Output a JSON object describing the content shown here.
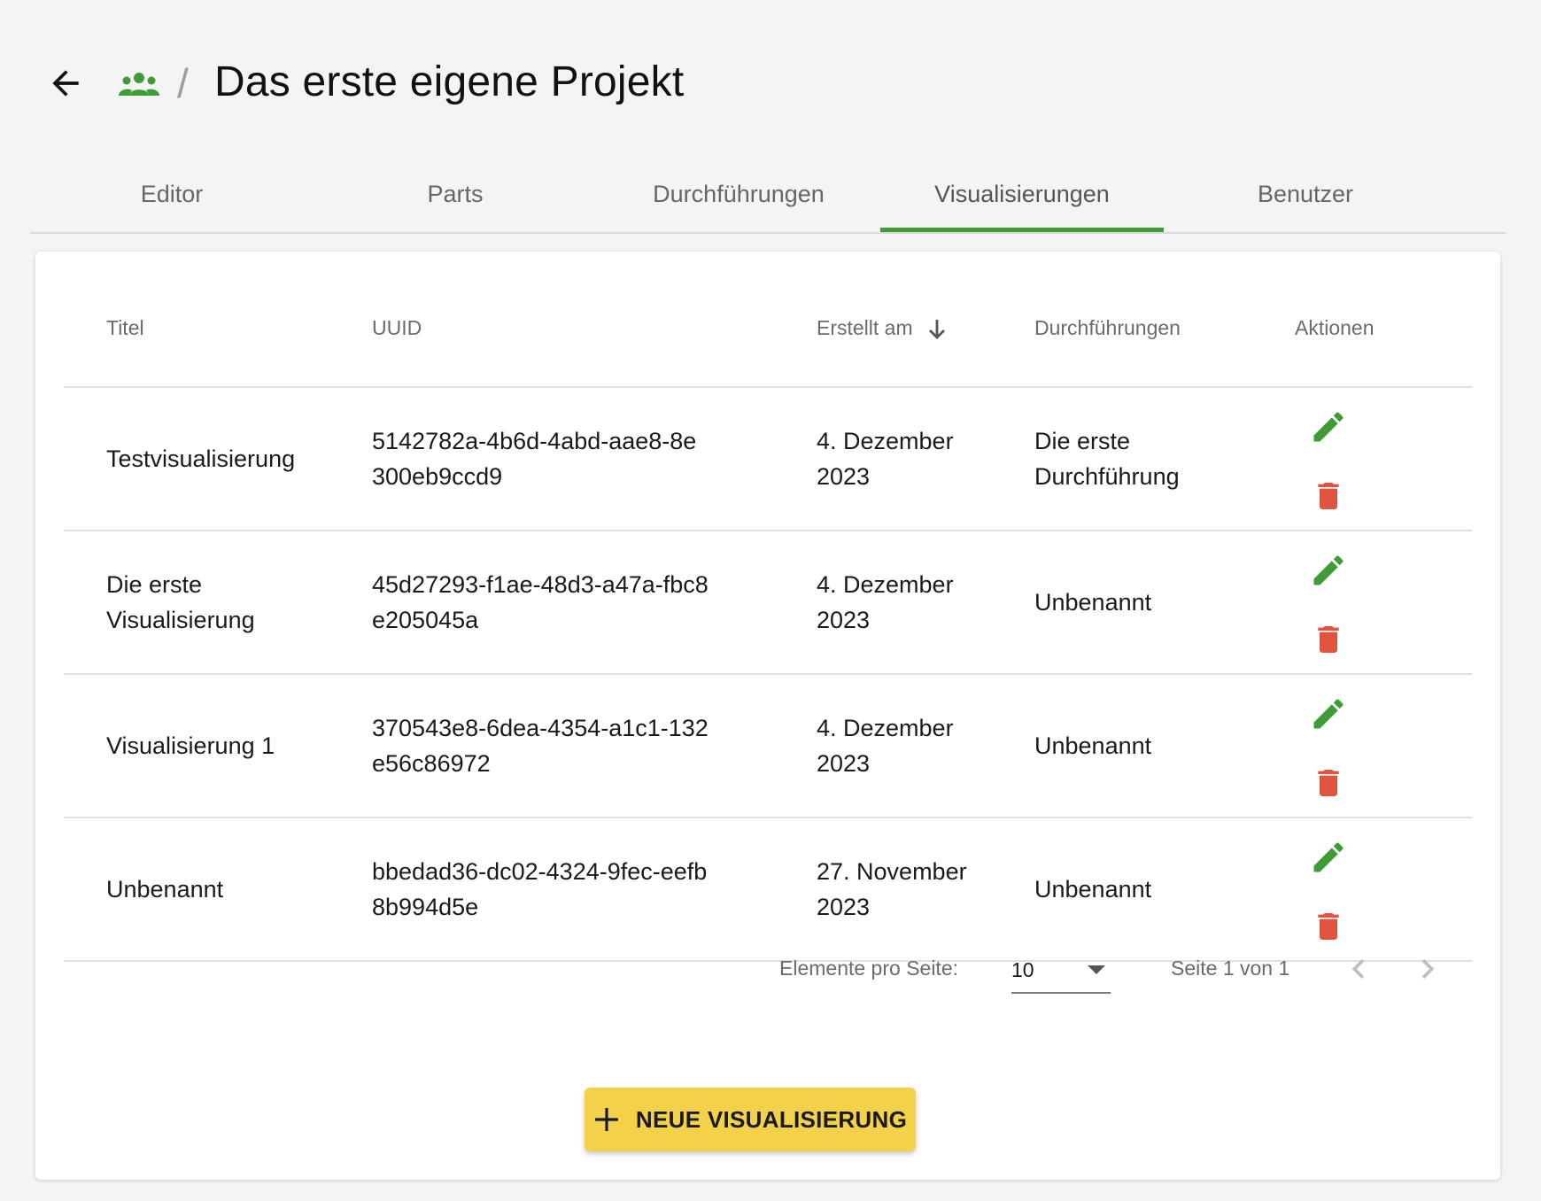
{
  "header": {
    "title": "Das erste eigene Projekt",
    "separator": "/",
    "back_icon": "arrow-left-icon",
    "crumb_icon": "group-icon"
  },
  "tabs": [
    {
      "label": "Editor",
      "active": false
    },
    {
      "label": "Parts",
      "active": false
    },
    {
      "label": "Durchführungen",
      "active": false
    },
    {
      "label": "Visualisierungen",
      "active": true
    },
    {
      "label": "Benutzer",
      "active": false
    }
  ],
  "table": {
    "columns": [
      "Titel",
      "UUID",
      "Erstellt am",
      "Durchführungen",
      "Aktionen"
    ],
    "sort_column": "Erstellt am",
    "sort_direction": "descending",
    "rows": [
      {
        "title": "Testvisualisierung",
        "uuid": "5142782a-4b6d-4abd-aae8-8e300eb9ccd9",
        "created": "4. Dezember 2023",
        "durchfuehrung": "Die erste Durchführung"
      },
      {
        "title": "Die erste Visualisierung",
        "uuid": "45d27293-f1ae-48d3-a47a-fbc8e205045a",
        "created": "4. Dezember 2023",
        "durchfuehrung": "Unbenannt"
      },
      {
        "title": "Visualisierung 1",
        "uuid": "370543e8-6dea-4354-a1c1-132e56c86972",
        "created": "4. Dezember 2023",
        "durchfuehrung": "Unbenannt"
      },
      {
        "title": "Unbenannt",
        "uuid": "bbedad36-dc02-4324-9fec-eefb8b994d5e",
        "created": "27. November 2023",
        "durchfuehrung": "Unbenannt"
      }
    ]
  },
  "paginator": {
    "items_label": "Elemente pro Seite:",
    "items_value": "10",
    "range_label": "Seite 1 von 1"
  },
  "actions": {
    "new_label": "NEUE VISUALISIERUNG"
  },
  "colors": {
    "accent_green": "#3e9b36",
    "delete_red": "#e0533f",
    "button_yellow": "#f3d14b"
  }
}
